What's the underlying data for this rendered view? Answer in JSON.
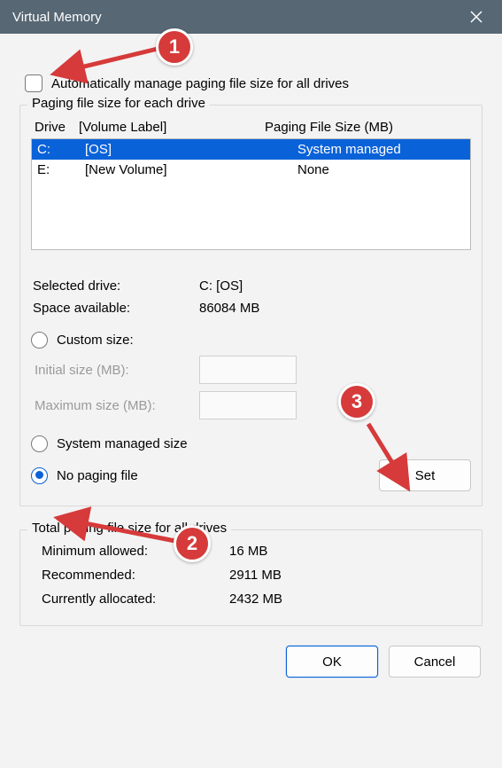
{
  "title": "Virtual Memory",
  "auto_manage_label": "Automatically manage paging file size for all drives",
  "auto_manage_checked": false,
  "drives_group": {
    "legend": "Paging file size for each drive",
    "headers": {
      "drive": "Drive",
      "label": "[Volume Label]",
      "size": "Paging File Size (MB)"
    },
    "rows": [
      {
        "drive": "C:",
        "label": "[OS]",
        "size": "System managed",
        "selected": true
      },
      {
        "drive": "E:",
        "label": "[New Volume]",
        "size": "None",
        "selected": false
      }
    ],
    "selected_drive_label": "Selected drive:",
    "selected_drive_value": "C:  [OS]",
    "space_label": "Space available:",
    "space_value": "86084 MB",
    "custom_size_label": "Custom size:",
    "initial_label": "Initial size (MB):",
    "maximum_label": "Maximum size (MB):",
    "system_managed_label": "System managed size",
    "no_paging_label": "No paging file",
    "set_label": "Set",
    "selected_option": "no_paging"
  },
  "totals_group": {
    "legend": "Total paging file size for all drives",
    "min_label": "Minimum allowed:",
    "min_value": "16 MB",
    "rec_label": "Recommended:",
    "rec_value": "2911 MB",
    "cur_label": "Currently allocated:",
    "cur_value": "2432 MB"
  },
  "buttons": {
    "ok": "OK",
    "cancel": "Cancel"
  },
  "annotations": {
    "badge1": "1",
    "badge2": "2",
    "badge3": "3"
  }
}
